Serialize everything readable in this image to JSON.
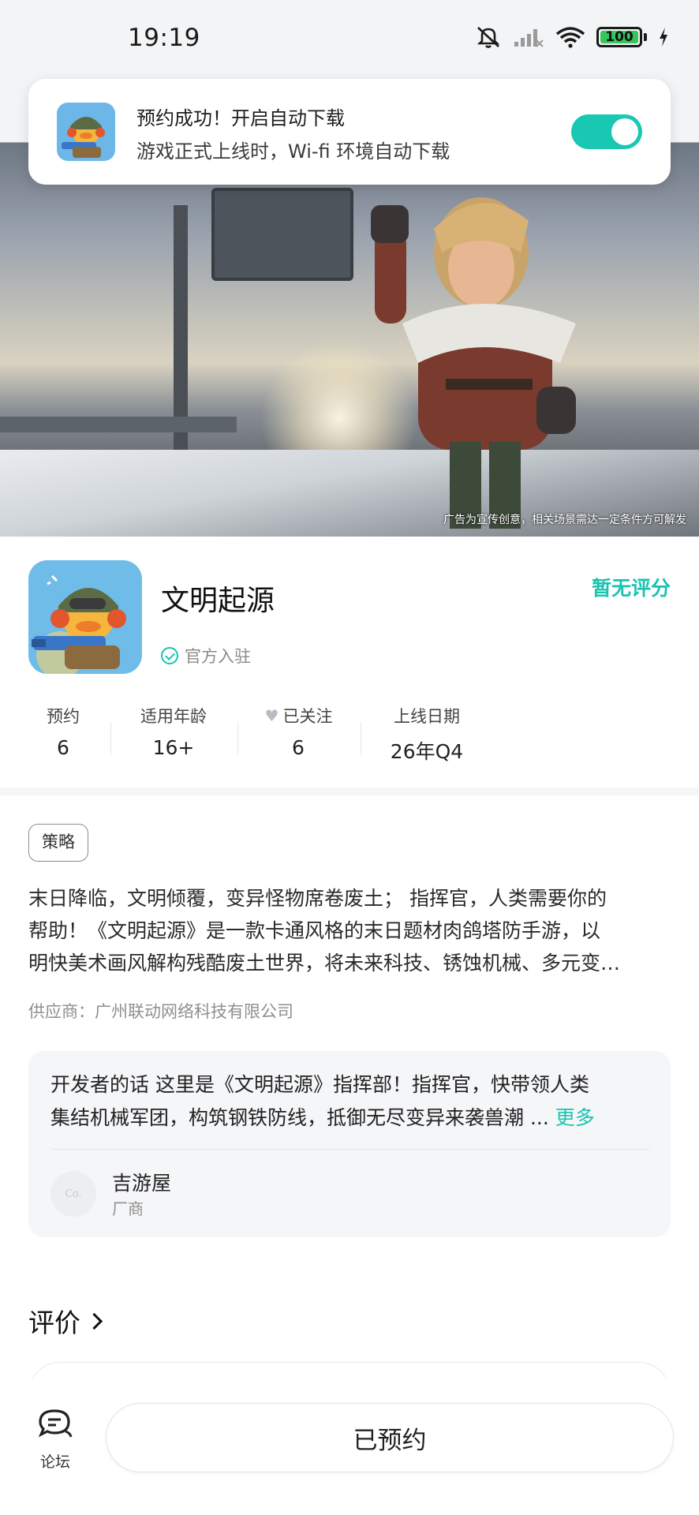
{
  "status_bar": {
    "time": "19:19",
    "battery": "100",
    "icons": [
      "mute-bell-icon",
      "signal-icon",
      "wifi-icon",
      "battery-icon",
      "charging-icon"
    ]
  },
  "toast": {
    "title": "预约成功！开启自动下载",
    "subtitle": "游戏正式上线时，Wi-fi 环境自动下载",
    "toggle_on": true
  },
  "hero": {
    "disclaimer": "广告为宣传创意，相关场景需达一定条件方可解发"
  },
  "app": {
    "name": "文明起源",
    "rating": "暂无评分",
    "official": "官方入驻"
  },
  "stats": [
    {
      "label": "预约",
      "value": "6"
    },
    {
      "label": "适用年龄",
      "value": "16+"
    },
    {
      "label": "已关注",
      "value": "6"
    },
    {
      "label": "上线日期",
      "value": "26年Q4"
    }
  ],
  "tag": "策略",
  "description": {
    "lines": [
      "末日降临，文明倾覆，变异怪物席卷废土； 指挥官，人类需要你的",
      "帮助！《文明起源》是一款卡通风格的末日题材肉鸽塔防手游，以",
      "明快美术画风解构残酷废土世界，将未来科技、锈蚀机械、多元变…"
    ]
  },
  "supplier": "供应商：广州联动网络科技有限公司",
  "developer": {
    "text_line1": "开发者的话  这里是《文明起源》指挥部！指挥官，快带领人类",
    "text_line2": "集结机械军团，构筑钢铁防线，抵御无尽变异来袭兽潮 ...",
    "more": "更多",
    "avatar_text": "Co.",
    "name": "吉游屋",
    "role": "厂商"
  },
  "reviews": {
    "title": "评价"
  },
  "bottom": {
    "forum_label": "论坛",
    "button_label": "已预约"
  },
  "colors": {
    "accent": "#19c3b0",
    "toggle": "#19c8b2"
  }
}
